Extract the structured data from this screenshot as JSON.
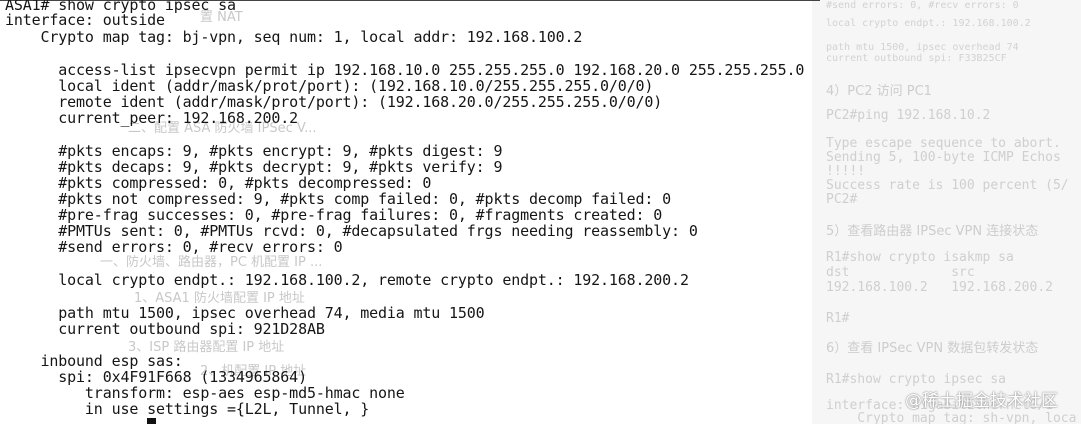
{
  "terminal": {
    "lines": [
      "ASA1# show crypto ipsec sa",
      "interface: outside",
      "    Crypto map tag: bj-vpn, seq num: 1, local addr: 192.168.100.2",
      "",
      "      access-list ipsecvpn permit ip 192.168.10.0 255.255.255.0 192.168.20.0 255.255.255.0",
      "      local ident (addr/mask/prot/port): (192.168.10.0/255.255.255.0/0/0)",
      "      remote ident (addr/mask/prot/port): (192.168.20.0/255.255.255.0/0/0)",
      "      current_peer: 192.168.200.2",
      "",
      "      #pkts encaps: 9, #pkts encrypt: 9, #pkts digest: 9",
      "      #pkts decaps: 9, #pkts decrypt: 9, #pkts verify: 9",
      "      #pkts compressed: 0, #pkts decompressed: 0",
      "      #pkts not compressed: 9, #pkts comp failed: 0, #pkts decomp failed: 0",
      "      #pre-frag successes: 0, #pre-frag failures: 0, #fragments created: 0",
      "      #PMTUs sent: 0, #PMTUs rcvd: 0, #decapsulated frgs needing reassembly: 0",
      "      #send errors: 0, #recv errors: 0",
      "",
      "      local crypto endpt.: 192.168.100.2, remote crypto endpt.: 192.168.200.2",
      "",
      "      path mtu 1500, ipsec overhead 74, media mtu 1500",
      "      current outbound spi: 921D28AB",
      "",
      "    inbound esp sas:",
      "      spi: 0x4F91F668 (1334965864)",
      "         transform: esp-aes esp-md5-hmac none",
      "         in use settings ={L2L, Tunnel, }"
    ]
  },
  "background_doc": {
    "ghost_headings": [
      "置 NAT",
      "二、配置 ASA 防火墙 IPSec V...",
      "一、防火墙、路由器，PC 机配置 IP ...",
      "1、ASA1 防火墙配置 IP 地址",
      "3、ISP 路由器配置 IP 地址",
      "2、机配置 IP 地址"
    ],
    "right_panel": {
      "top_lines": [
        "#send errors: 0, #recv errors: 0",
        "local crypto endpt.: 192.168.100.2",
        "path mtu 1500, ipsec overhead 74",
        "current outbound spi: F33B25CF"
      ],
      "step4_heading": "4）PC2 访问 PC1",
      "step4_code": [
        "PC2#ping 192.168.10.2",
        "",
        "Type escape sequence to abort.",
        "Sending 5, 100-byte ICMP Echos",
        "!!!!!",
        "Success rate is 100 percent (5/",
        "PC2#"
      ],
      "step5_heading": "5）查看路由器 IPSec VPN 连接状态",
      "step5_code": [
        "R1#show crypto isakmp sa",
        "dst             src",
        "192.168.100.2   192.168.200.2",
        "",
        "R1#"
      ],
      "step6_heading": "6）查看 IPSec VPN 数据包转发状态",
      "step6_code": [
        "R1#show crypto ipsec sa",
        "",
        "interface: GigabitEthernet0/1",
        "    Crypto map tag: sh-vpn, loca"
      ]
    }
  },
  "watermark": "@稀土掘金技术社区",
  "colors": {
    "terminal_text": "#151515",
    "background": "#ffffff",
    "right_panel_bg": "#f6f6f6",
    "faded_text": "#cccccc"
  }
}
